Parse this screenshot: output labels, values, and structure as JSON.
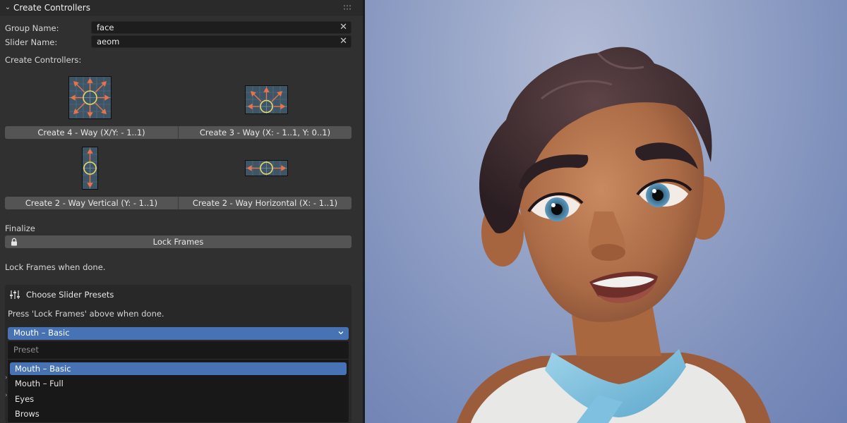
{
  "panel": {
    "title": "Create Controllers",
    "group_name_label": "Group Name:",
    "group_name_value": "face",
    "slider_name_label": "Slider Name:",
    "slider_name_value": "aeom",
    "create_controllers_label": "Create Controllers:",
    "buttons": {
      "four_way": "Create 4 - Way (X/Y: - 1..1)",
      "three_way": "Create 3 - Way (X: - 1..1, Y: 0..1)",
      "two_way_vertical": "Create 2 - Way Vertical (Y: - 1..1)",
      "two_way_horizontal": "Create 2 - Way Horizontal (X: - 1..1)"
    },
    "finalize_label": "Finalize",
    "lock_frames_label": "Lock Frames",
    "lock_frames_hint": "Lock Frames when done.",
    "accent_color": "#4772b3",
    "arrow_color": "#e8734a",
    "circle_color": "#e8d86a"
  },
  "presets": {
    "title": "Choose Slider Presets",
    "hint": "Press 'Lock Frames' above when done.",
    "selected": "Mouth – Basic",
    "menu_title": "Preset",
    "options": [
      {
        "label": "Mouth – Basic",
        "active": true
      },
      {
        "label": "Mouth – Full",
        "active": false
      },
      {
        "label": "Eyes",
        "active": false
      },
      {
        "label": "Brows",
        "active": false
      }
    ]
  }
}
